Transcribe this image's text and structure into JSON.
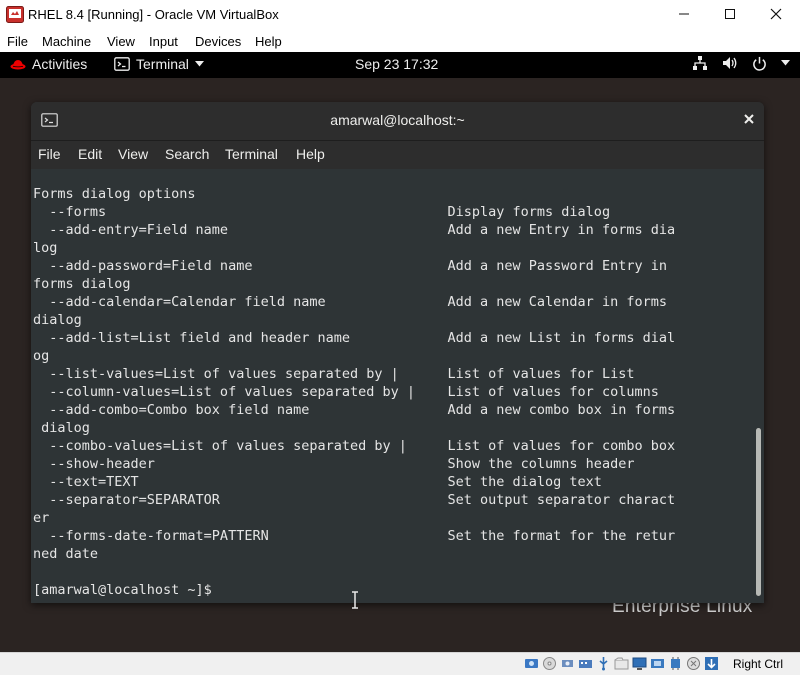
{
  "vbox": {
    "title": "RHEL 8.4 [Running] - Oracle VM VirtualBox",
    "menu": [
      "File",
      "Machine",
      "View",
      "Input",
      "Devices",
      "Help"
    ],
    "host_key": "Right Ctrl"
  },
  "gnome": {
    "activities": "Activities",
    "app_menu": "Terminal",
    "clock": "Sep 23  17:32"
  },
  "desktop": {
    "branding": "Enterprise Linux"
  },
  "terminal": {
    "title": "amarwal@localhost:~",
    "menu": [
      "File",
      "Edit",
      "View",
      "Search",
      "Terminal",
      "Help"
    ],
    "content": "Forms dialog options\n  --forms                                          Display forms dialog\n  --add-entry=Field name                           Add a new Entry in forms dia\nlog\n  --add-password=Field name                        Add a new Password Entry in \nforms dialog\n  --add-calendar=Calendar field name               Add a new Calendar in forms \ndialog\n  --add-list=List field and header name            Add a new List in forms dial\nog\n  --list-values=List of values separated by |      List of values for List\n  --column-values=List of values separated by |    List of values for columns\n  --add-combo=Combo box field name                 Add a new combo box in forms\n dialog\n  --combo-values=List of values separated by |     List of values for combo box\n  --show-header                                    Show the columns header\n  --text=TEXT                                      Set the dialog text\n  --separator=SEPARATOR                            Set output separator charact\ner\n  --forms-date-format=PATTERN                      Set the format for the retur\nned date\n\n[amarwal@localhost ~]$"
  },
  "colors": {
    "terminal_bg": "#2e3436",
    "terminal_fg": "#e5e5e5",
    "desktop_bg": "#2b2422",
    "gnome_bar": "#000000",
    "vbox_icon": "#c9302c"
  }
}
